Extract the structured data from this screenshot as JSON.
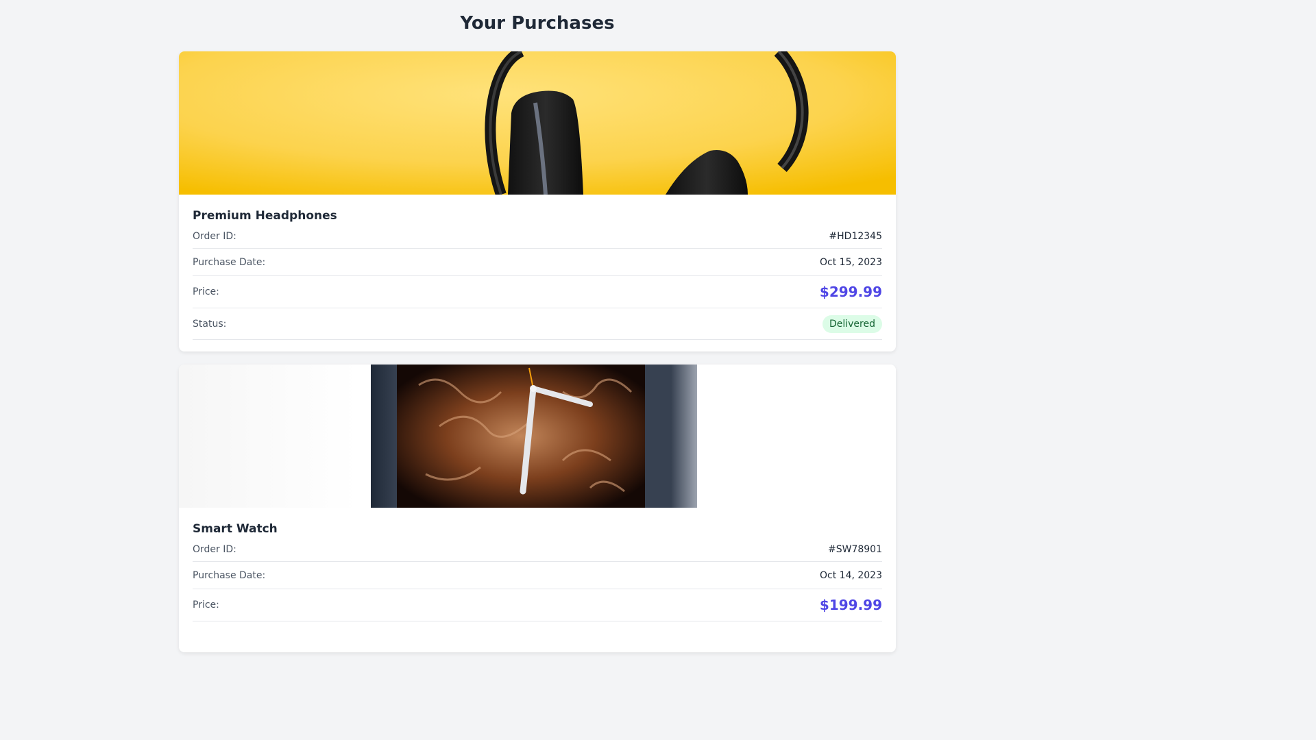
{
  "page": {
    "title": "Your Purchases"
  },
  "purchases": [
    {
      "name": "Premium Headphones",
      "order_id_label": "Order ID:",
      "order_id": "#HD12345",
      "date_label": "Purchase Date:",
      "date": "Oct 15, 2023",
      "price_label": "Price:",
      "price": "$299.99",
      "status_label": "Status:",
      "status": "Delivered"
    },
    {
      "name": "Smart Watch",
      "order_id_label": "Order ID:",
      "order_id": "#SW78901",
      "date_label": "Purchase Date:",
      "date": "Oct 14, 2023",
      "price_label": "Price:",
      "price": "$199.99"
    }
  ],
  "colors": {
    "background": "#f3f4f6",
    "accent": "#4f46e5",
    "status_delivered_bg": "#dcfce7",
    "status_delivered_text": "#166534",
    "headphones_image_bg": "#fcd34d"
  }
}
